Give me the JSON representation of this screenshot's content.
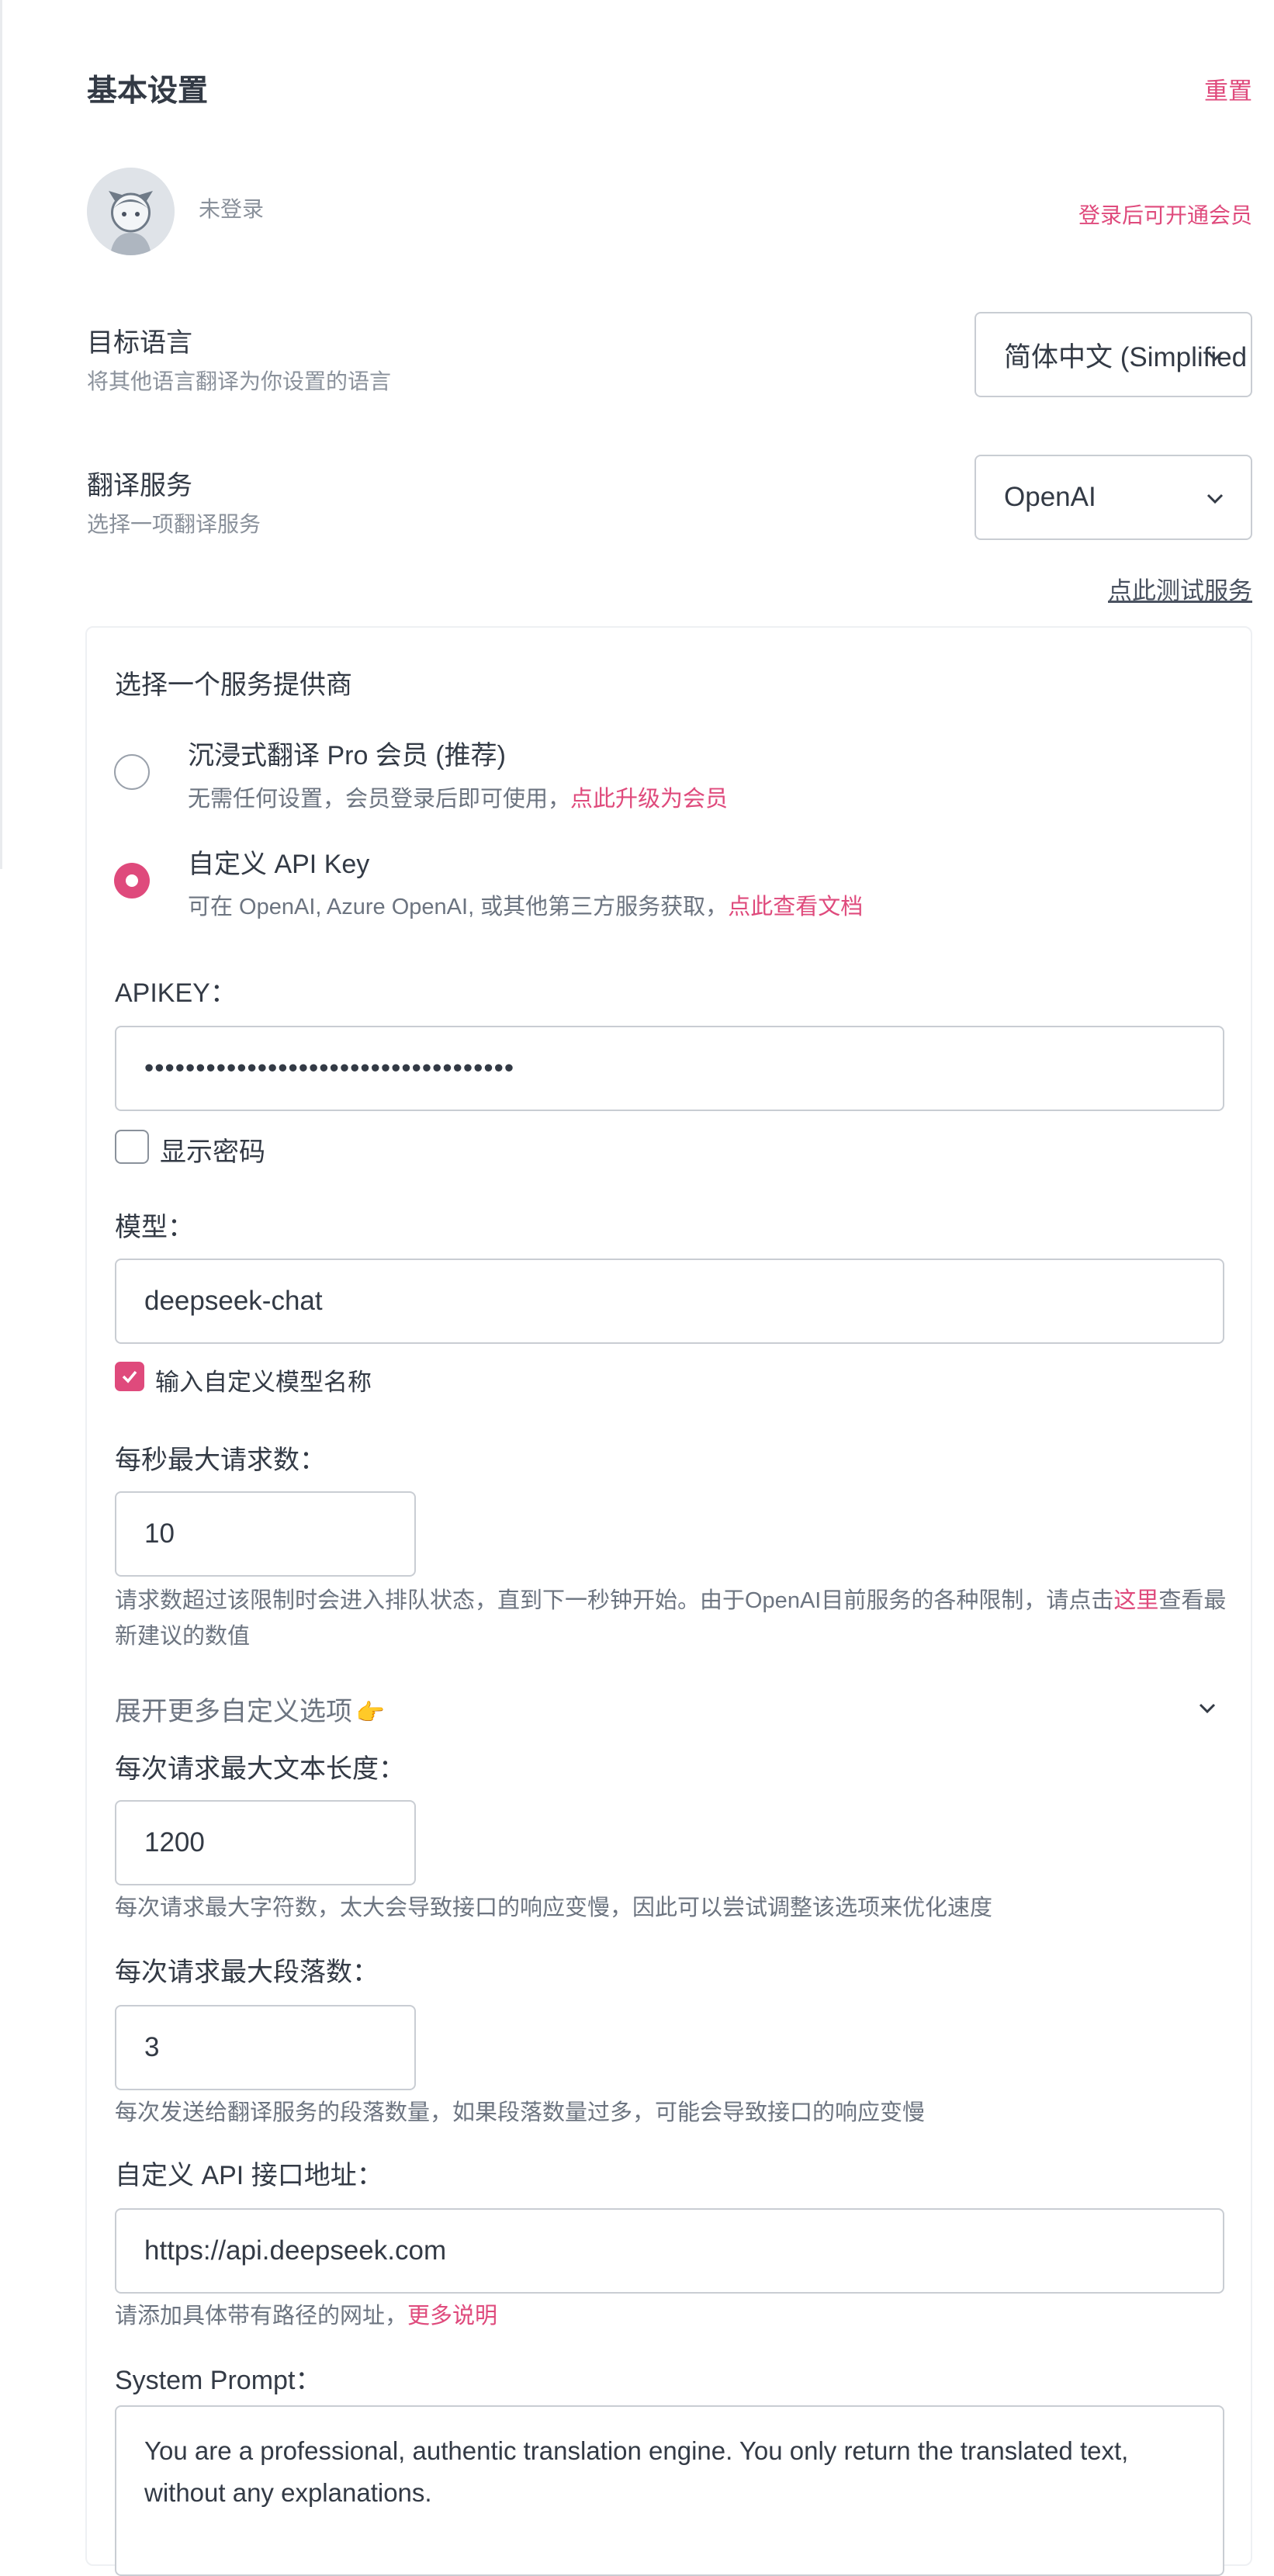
{
  "header": {
    "title": "基本设置",
    "reset_label": "重置"
  },
  "account": {
    "status": "未登录",
    "upgrade_link": "登录后可开通会员"
  },
  "target_language": {
    "label": "目标语言",
    "description": "将其他语言翻译为你设置的语言",
    "selected": "简体中文 (Simplified Chinese)"
  },
  "translation_service": {
    "label": "翻译服务",
    "description": "选择一项翻译服务",
    "selected": "OpenAI",
    "test_link": "点此测试服务"
  },
  "provider": {
    "title": "选择一个服务提供商",
    "options": [
      {
        "title": "沉浸式翻译 Pro 会员 (推荐)",
        "description": "无需任何设置，会员登录后即可使用，",
        "link": "点此升级为会员",
        "selected": false
      },
      {
        "title": "自定义 API Key",
        "description": "可在 OpenAI, Azure OpenAI, 或其他第三方服务获取，",
        "link": "点此查看文档",
        "selected": true
      }
    ]
  },
  "apikey": {
    "label": "APIKEY：",
    "value": "••••••••••••••••••••••••••••••••••••",
    "show_password_label": "显示密码",
    "show_password_checked": false
  },
  "model": {
    "label": "模型：",
    "value": "deepseek-chat",
    "custom_name_label": "输入自定义模型名称",
    "custom_name_checked": true
  },
  "rate_limit": {
    "label": "每秒最大请求数：",
    "value": "10",
    "hint_before": "请求数超过该限制时会进入排队状态，直到下一秒钟开始。由于OpenAI目前服务的各种限制，请点击",
    "hint_link": "这里",
    "hint_after": "查看最新建议的数值"
  },
  "expand": {
    "label": "展开更多自定义选项",
    "emoji": "👉"
  },
  "max_text_length": {
    "label": "每次请求最大文本长度：",
    "value": "1200",
    "hint": "每次请求最大字符数，太大会导致接口的响应变慢，因此可以尝试调整该选项来优化速度"
  },
  "max_paragraphs": {
    "label": "每次请求最大段落数：",
    "value": "3",
    "hint": "每次发送给翻译服务的段落数量，如果段落数量过多，可能会导致接口的响应变慢"
  },
  "api_url": {
    "label": "自定义 API 接口地址：",
    "value": "https://api.deepseek.com",
    "hint": "请添加具体带有路径的网址，",
    "hint_link": "更多说明"
  },
  "system_prompt": {
    "label": "System Prompt：",
    "value": "You are a professional, authentic translation engine. You only return the translated text, without any explanations."
  },
  "colors": {
    "accent": "#df4a7c",
    "text": "#333a45",
    "muted": "#8a919b",
    "border": "#c9cdd3"
  },
  "icons": [
    "chevron-down-icon",
    "avatar-icon",
    "checkmark-icon",
    "pointing-hand-emoji"
  ]
}
